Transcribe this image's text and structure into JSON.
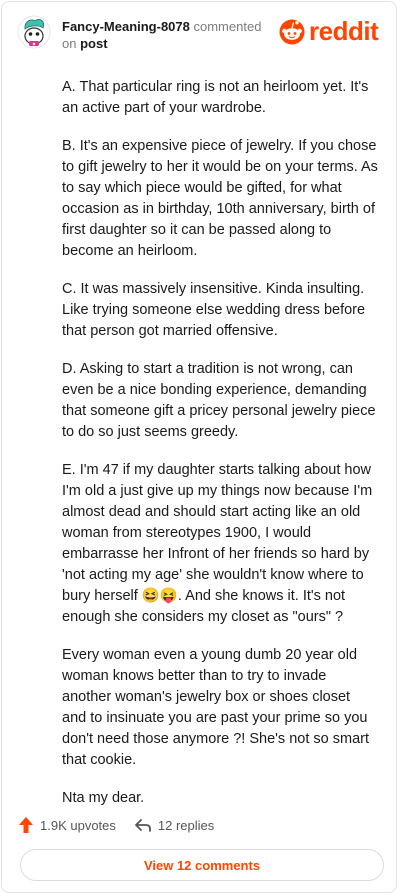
{
  "comment": {
    "username": "Fancy-Meaning-8078",
    "action": "commented",
    "on_word": "on",
    "target": "post"
  },
  "brand": {
    "wordmark": "reddit",
    "icon": "reddit-snoo-icon",
    "accent_color": "#ff4500"
  },
  "body": {
    "paragraphs": [
      "A. That particular ring is not an heirloom yet. It's an active part of your wardrobe.",
      "B. It's an expensive piece of jewelry. If you chose to gift jewelry to her it would be on your terms. As to say which piece would be gifted, for what occasion as in birthday, 10th anniversary, birth of first daughter so it can be passed along to become an heirloom.",
      "C. It was massively insensitive. Kinda insulting. Like trying someone else wedding dress before that person got married offensive.",
      "D. Asking to start a tradition is not wrong, can even be a nice bonding experience, demanding that someone gift a pricey personal jewelry piece to do so just seems greedy.",
      "E. I'm 47 if my daughter starts talking about how I'm old a just give up my things now because I'm almost dead and should start acting like an old woman from stereotypes 1900, I would embarrasse her Infront of her friends so hard by 'not acting my age' she wouldn't know where to bury herself 😆😝. And she knows it. It's not enough she considers my closet as \"ours\" ?",
      "Every woman even a young dumb 20 year old woman knows better than to try to invade another woman's jewelry box or shoes closet and to insinuate you are past your prime so you don't need those anymore ?! She's not so smart that cookie.",
      "Nta my dear."
    ]
  },
  "footer": {
    "upvotes": "1.9K upvotes",
    "replies": "12 replies",
    "view_comments": "View 12 comments",
    "upvote_icon": "upvote-arrow-icon",
    "reply_icon": "reply-arrow-icon"
  }
}
